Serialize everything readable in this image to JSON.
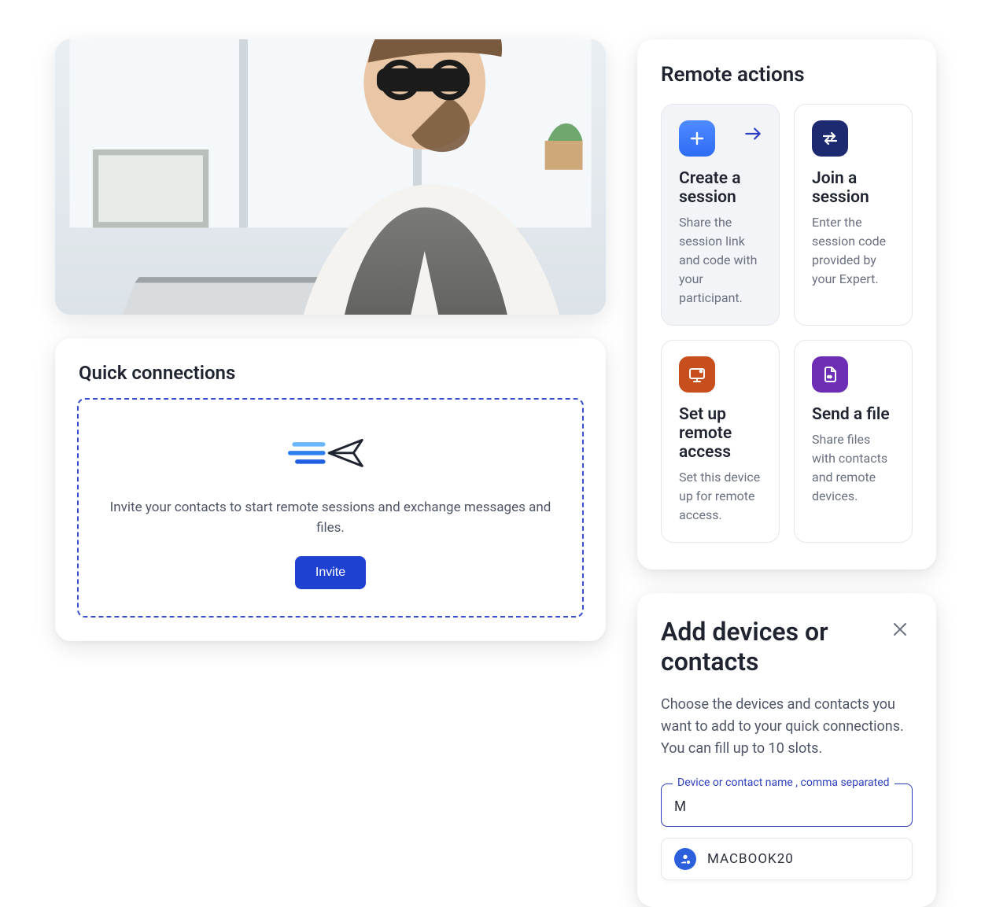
{
  "remoteActions": {
    "title": "Remote actions",
    "tiles": [
      {
        "title": "Create a session",
        "desc": "Share the session link and code with your participant.",
        "iconColor": "blue",
        "selected": true
      },
      {
        "title": "Join a session",
        "desc": "Enter the session code provided by your Expert.",
        "iconColor": "navy",
        "selected": false
      },
      {
        "title": "Set up remote access",
        "desc": "Set this device up for remote access.",
        "iconColor": "orange",
        "selected": false
      },
      {
        "title": "Send a file",
        "desc": "Share files with contacts and remote devices.",
        "iconColor": "purple",
        "selected": false
      }
    ]
  },
  "addDevices": {
    "title": "Add devices or contacts",
    "description": "Choose the devices and contacts you want to add to your quick connections. You can fill up to 10 slots.",
    "field": {
      "label": "Device or contact name , comma separated",
      "value": "M"
    },
    "suggestion": "MACBOOK20"
  },
  "quickConnections": {
    "title": "Quick connections",
    "text": "Invite your contacts to start remote sessions and exchange messages and files.",
    "button": "Invite"
  }
}
